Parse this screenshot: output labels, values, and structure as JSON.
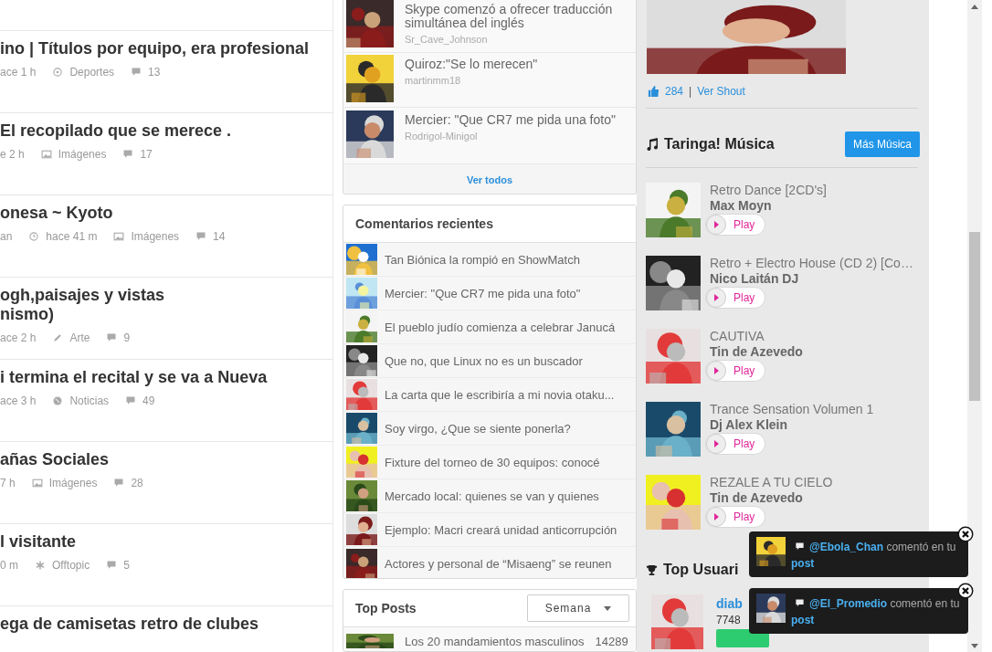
{
  "posts": [
    {
      "title_lines": [
        "ino | Títulos por equipo, era profesional"
      ],
      "meta": [
        {
          "kind": "text",
          "text": "ace 1 h"
        },
        {
          "kind": "sports",
          "text": "Deportes"
        },
        {
          "kind": "comments",
          "text": "13"
        }
      ]
    },
    {
      "title_lines": [
        "El recopilado que se merece ."
      ],
      "meta": [
        {
          "kind": "text",
          "text": "e 2 h"
        },
        {
          "kind": "images",
          "text": "Imágenes"
        },
        {
          "kind": "comments",
          "text": "17"
        }
      ]
    },
    {
      "title_lines": [
        "onesa ~ Kyoto"
      ],
      "meta": [
        {
          "kind": "text",
          "text": "an"
        },
        {
          "kind": "time",
          "text": "hace 41 m"
        },
        {
          "kind": "images",
          "text": "Imágenes"
        },
        {
          "kind": "comments",
          "text": "14"
        }
      ]
    },
    {
      "title_lines": [
        "ogh,paisajes y vistas",
        "nismo)"
      ],
      "meta": [
        {
          "kind": "text",
          "text": "ace 2 h"
        },
        {
          "kind": "art",
          "text": "Arte"
        },
        {
          "kind": "comments",
          "text": "9"
        }
      ]
    },
    {
      "title_lines": [
        "i termina el recital y se va a Nueva"
      ],
      "meta": [
        {
          "kind": "text",
          "text": "ace 3 h"
        },
        {
          "kind": "news",
          "text": "Noticias"
        },
        {
          "kind": "comments",
          "text": "49"
        }
      ]
    },
    {
      "title_lines": [
        "añas Sociales"
      ],
      "meta": [
        {
          "kind": "text",
          "text": "7 h"
        },
        {
          "kind": "images",
          "text": "Imágenes"
        },
        {
          "kind": "comments",
          "text": "28"
        }
      ]
    },
    {
      "title_lines": [
        "l visitante"
      ],
      "meta": [
        {
          "kind": "text",
          "text": "0 m"
        },
        {
          "kind": "offtopic",
          "text": "Offtopic"
        },
        {
          "kind": "comments",
          "text": "5"
        }
      ]
    },
    {
      "title_lines": [
        "ega de camisetas retro de clubes"
      ]
    }
  ],
  "featured_news": {
    "items": [
      {
        "title": "Skype comenzó a ofrecer traducción simultánea del inglés",
        "author": "Sr_Cave_Johnson"
      },
      {
        "title": "Quiroz:\"Se lo merecen\"",
        "author": "martinmm18"
      },
      {
        "title": "Mercier: \"Que CR7 me pida una foto\"",
        "author": "Rodrigol-Minigol"
      }
    ],
    "footer_link": "Ver todos"
  },
  "recent_comments": {
    "title": "Comentarios recientes",
    "items": [
      "Tan Biónica la rompió en ShowMatch",
      "Mercier: \"Que CR7 me pida una foto\"",
      "El pueblo judío comienza a celebrar Janucá",
      "Que no, que Linux no es un buscador",
      "La carta que le escribiría a mi novia otaku...",
      "Soy virgo, ¿Que se siente ponerla?",
      "Fixture del torneo de 30 equipos: conocé",
      "Mercado local: quienes se van y quienes",
      "Ejemplo: Macri creará unidad anticorrupción",
      "Actores y personal de “Misaeng” se reunen"
    ]
  },
  "top_posts": {
    "title": "Top Posts",
    "period": "Semana",
    "items": [
      {
        "title": "Los 20 mandamientos masculinos",
        "score": "14289"
      }
    ]
  },
  "shout": {
    "likes": "284",
    "separator": "|",
    "link": "Ver Shout"
  },
  "music": {
    "title": "Taringa! Música",
    "button": "Más Música",
    "items": [
      {
        "title": "Retro Dance [2CD's]",
        "artist": "Max Moyn",
        "action": "Play"
      },
      {
        "title": "Retro + Electro House (CD 2) [Co…",
        "artist": "Nico Laitán DJ",
        "action": "Play"
      },
      {
        "title": "CAUTIVA",
        "artist": "Tin de Azevedo",
        "action": "Play"
      },
      {
        "title": "Trance Sensation Volumen 1",
        "artist": "Dj Alex Klein",
        "action": "Play"
      },
      {
        "title": "REZALE A TU CIELO",
        "artist": "Tin de Azevedo",
        "action": "Play"
      }
    ]
  },
  "top_users": {
    "title": "Top Usuari",
    "users": [
      {
        "name": "diab",
        "points": "7748"
      }
    ]
  },
  "notifications": [
    {
      "user": "@Ebola_Chan",
      "text": "comentó en tu",
      "link": "post"
    },
    {
      "user": "@El_Promedio",
      "text": "comentó en tu",
      "link": "post"
    }
  ]
}
